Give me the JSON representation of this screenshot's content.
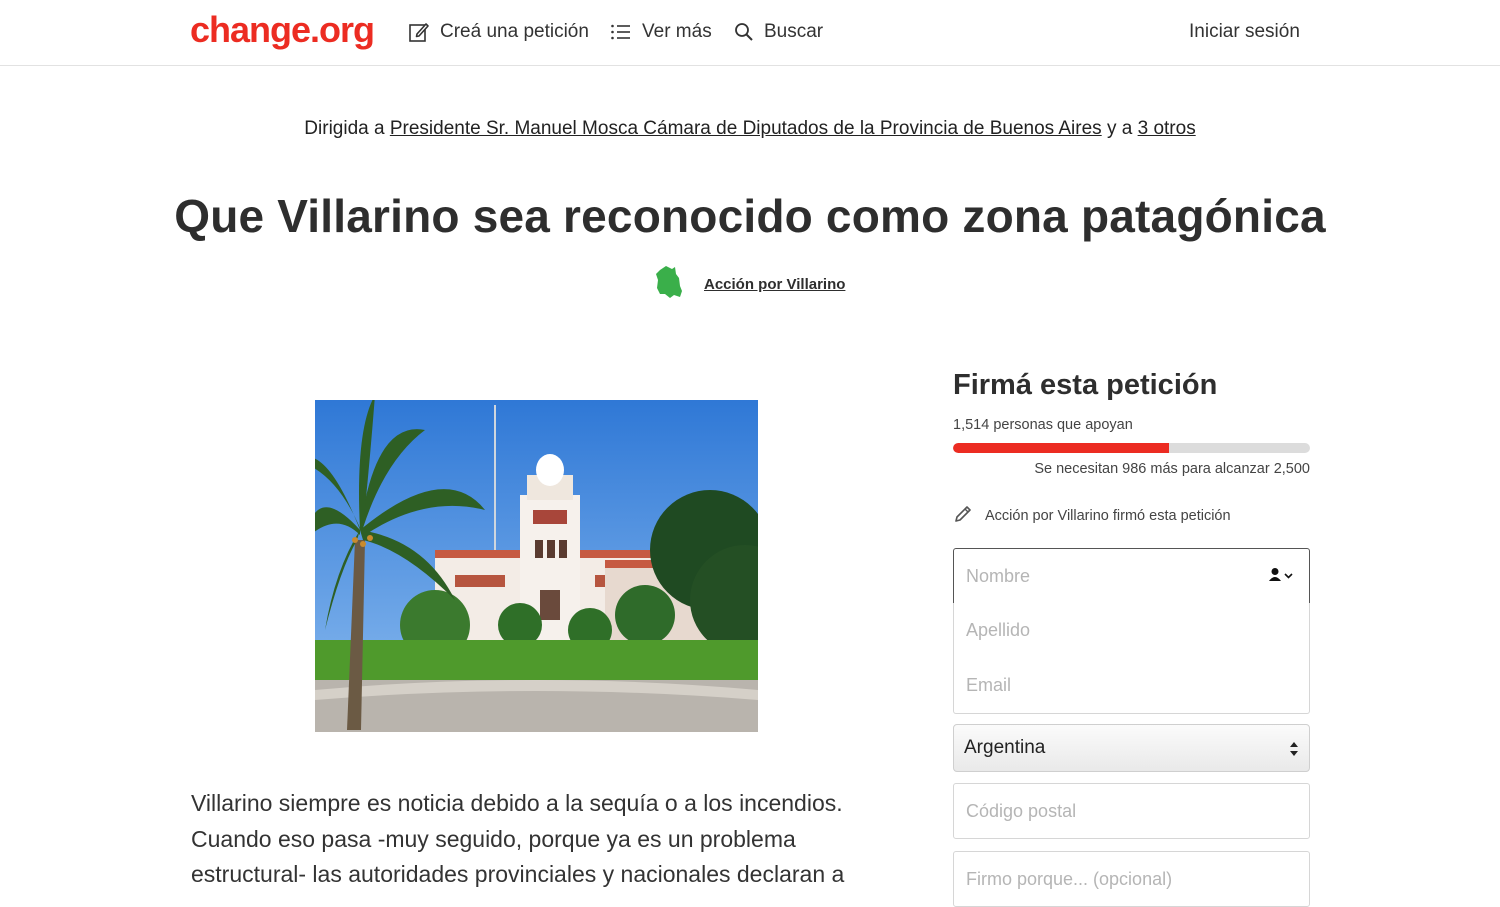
{
  "header": {
    "logo": "change.org",
    "nav": {
      "create": "Creá una petición",
      "more": "Ver más",
      "search": "Buscar",
      "login": "Iniciar sesión"
    }
  },
  "petition": {
    "directed_prefix": "Dirigida a",
    "directed_target": "Presidente Sr. Manuel Mosca Cámara de Diputados de la Provincia de Buenos Aires",
    "directed_join": "y a",
    "directed_others": "3 otros",
    "title": "Que Villarino sea reconocido como zona patagónica",
    "author": "Acción por Villarino",
    "body": "Villarino siempre es noticia debido a la sequía o a los incendios. Cuando eso pasa -muy seguido, porque ya es un problema estructural- las autoridades provinciales y nacionales declaran a"
  },
  "sign_form": {
    "title": "Firmá esta petición",
    "supporters": "1,514 personas que apoyan",
    "progress_fraction": 0.6056,
    "needed": "Se necesitan 986 más para alcanzar 2,500",
    "recent_signer": "Acción por Villarino firmó esta petición",
    "placeholders": {
      "first_name": "Nombre",
      "last_name": "Apellido",
      "email": "Email",
      "zip": "Código postal",
      "reason": "Firmo porque... (opcional)"
    },
    "country": "Argentina"
  },
  "colors": {
    "brand": "#ec2c22",
    "author_badge": "#3aaf4a"
  }
}
